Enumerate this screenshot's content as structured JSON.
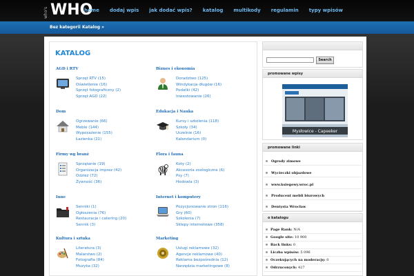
{
  "logo": {
    "small": "who's",
    "big": "WHO"
  },
  "nav": [
    {
      "label": "home"
    },
    {
      "label": "dodaj wpis"
    },
    {
      "label": "jak dodać wpis?"
    },
    {
      "label": "katalog"
    },
    {
      "label": "multikody"
    },
    {
      "label": "regulamin"
    },
    {
      "label": "typy wpisów"
    }
  ],
  "breadcrumb": {
    "first": "Bez kategorii",
    "second": "Katalog »"
  },
  "page_title": "KATALOG",
  "categories": [
    {
      "title": "AGD i RTV",
      "icon": "tv-icon",
      "subs": [
        "Sprzęt RTV (15)",
        "Oświetlenie (16)",
        "Sprzęt fotograficzny (2)",
        "Sprzęt AGD (22)"
      ]
    },
    {
      "title": "Biznes i ekonomia",
      "icon": "businessman-icon",
      "subs": [
        "Doradztwo (125)",
        "Windykacja długów (16)",
        "Podatki (42)",
        "Inwestowanie (26)"
      ]
    },
    {
      "title": "Dom",
      "icon": "house-icon",
      "subs": [
        "Ogrzewanie (66)",
        "Meble (144)",
        "Wyposażenie (155)",
        "Łazienka (21)"
      ]
    },
    {
      "title": "Edukacja i Nauka",
      "icon": "graduation-cap-icon",
      "subs": [
        "Kursy i szkolenia (118)",
        "Szkoły (34)",
        "Uczelnie (16)",
        "Kalendarium (0)"
      ]
    },
    {
      "title": "Firmy wg branż",
      "icon": "document-list-icon",
      "subs": [
        "Sprzątanie (19)",
        "Organizacja imprez (42)",
        "Odzież (72)",
        "Żywność (36)"
      ]
    },
    {
      "title": "Flora i fauna",
      "icon": "zebra-icon",
      "subs": [
        "Koty (2)",
        "Akcesoria zoologiczne (6)",
        "Psy (7)",
        "Hodowla (3)"
      ]
    },
    {
      "title": "Inne",
      "icon": "folder-icon",
      "subs": [
        "Senniki (1)",
        "Ogłoszenia (76)",
        "Restauracje i catering (20)",
        "Sennik (3)"
      ]
    },
    {
      "title": "Internet i komputery",
      "icon": "laptop-icon",
      "subs": [
        "Pozycjonowanie stron (116)",
        "Gry (60)",
        "Szkolenia (7)",
        "Sklepy internetowe (358)"
      ]
    },
    {
      "title": "Kultura i sztuka",
      "icon": "art-tools-icon",
      "subs": [
        "Literatura (3)",
        "Malarstwo (2)",
        "Fotografia (84)",
        "Muzyka (32)"
      ]
    },
    {
      "title": "Marketing",
      "icon": "speaker-icon",
      "subs": [
        "Usługi reklamowe (32)",
        "Agencje reklamowe (40)",
        "Reklama bezpośrednia (12)",
        "Narzędzia marketingowe (8)"
      ]
    }
  ],
  "search": {
    "placeholder": "",
    "button": "Search"
  },
  "promoted_posts": {
    "title": "promowane wpisy",
    "caption": "Mysłowice - Capeeker"
  },
  "promoted_links": {
    "title": "promowane linki",
    "items": [
      "Ogrody zimowe",
      "Wycieczki objazdowe",
      "www.ksiegowy.wroc.pl",
      "Producent mebli biurowych",
      "Dentysta Wrocław"
    ]
  },
  "about": {
    "title": "o katalogu",
    "stats": [
      {
        "label": "Page Rank:",
        "value": "N/A"
      },
      {
        "label": "Google site:",
        "value": "10 900"
      },
      {
        "label": "Back links:",
        "value": "0"
      },
      {
        "label": "Liczba wpisów:",
        "value": "5 096"
      },
      {
        "label": "Oczekujących na moderację:",
        "value": "0"
      },
      {
        "label": "Odrzuconych:",
        "value": "427"
      }
    ]
  }
}
